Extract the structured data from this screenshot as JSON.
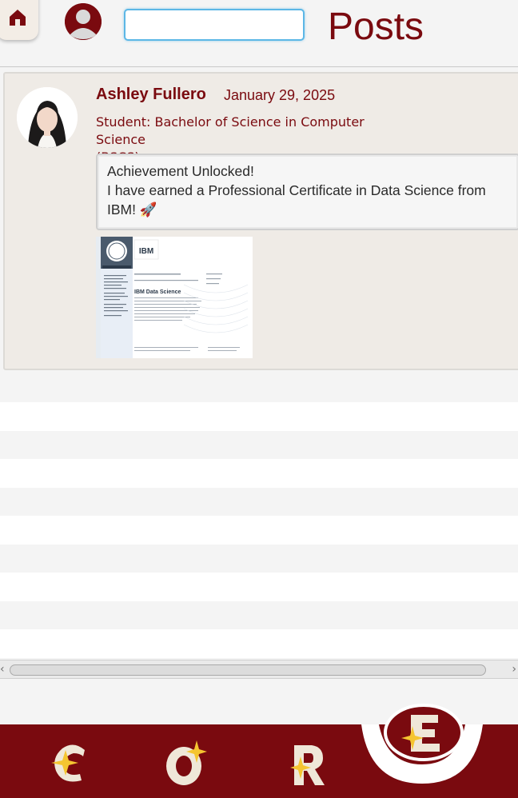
{
  "header": {
    "title": "Posts",
    "home_icon": "home-icon",
    "profile_icon": "user-icon",
    "search": {
      "value": "",
      "placeholder": ""
    }
  },
  "post": {
    "author_name": "Ashley Fullero",
    "date": "January 29, 2025",
    "role_line1": "Student: Bachelor of Science in Computer Science",
    "role_line2": "(BSCS)",
    "body_line1": "Achievement Unlocked!",
    "body_line2": "I have earned a Professional Certificate in Data Science from",
    "body_line3": "IBM! 🚀",
    "image_caption": "IBM Data Science",
    "image_logo": "IBM"
  },
  "bottom_nav": {
    "items": [
      {
        "letter": "C",
        "icon": "star-c-icon"
      },
      {
        "letter": "O",
        "icon": "star-o-icon"
      },
      {
        "letter": "R",
        "icon": "star-r-icon"
      },
      {
        "letter": "E",
        "icon": "star-e-icon",
        "active": true
      }
    ]
  },
  "colors": {
    "brand": "#7a0a0f",
    "card_bg": "#efebe6",
    "star": "#f5c531",
    "search_border": "#5cb7e6"
  }
}
